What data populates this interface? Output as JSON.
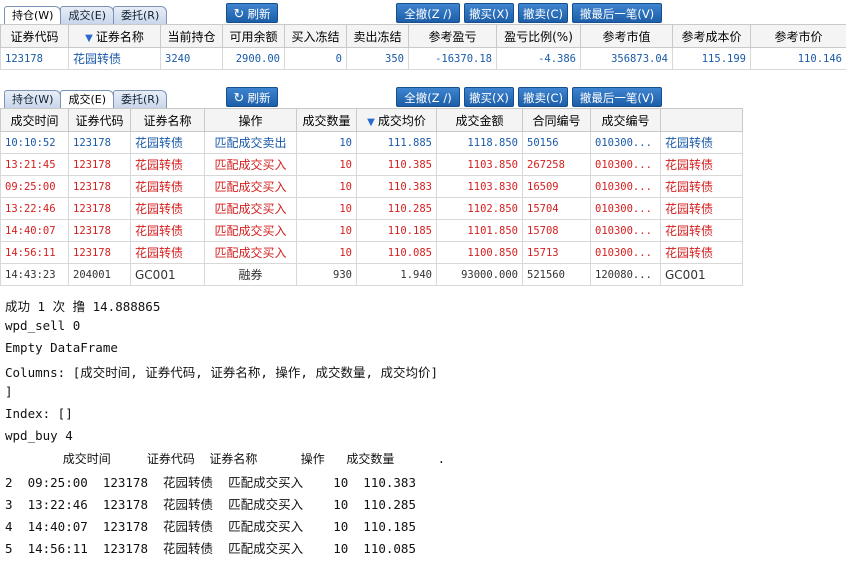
{
  "tabs": [
    "持仓(W)",
    "成交(E)",
    "委托(R)"
  ],
  "buttons": {
    "refresh": "刷新",
    "cancel_all": "全撤(Z /)",
    "cancel_buy": "撤买(X)",
    "cancel_sell": "撤卖(C)",
    "cancel_last": "撤最后一笔(V)"
  },
  "positions": {
    "headers": [
      "证券代码",
      "证券名称",
      "当前持仓",
      "可用余额",
      "买入冻结",
      "卖出冻结",
      "参考盈亏",
      "盈亏比例(%)",
      "参考市值",
      "参考成本价",
      "参考市价"
    ],
    "rows": [
      [
        "123178",
        "花园转债",
        "3240",
        "2900.00",
        "0",
        "350",
        "-16370.18",
        "-4.386",
        "356873.04",
        "115.199",
        "110.146"
      ]
    ]
  },
  "trades": {
    "headers": [
      "成交时间",
      "证券代码",
      "证券名称",
      "操作",
      "成交数量",
      "成交均价",
      "成交金额",
      "合同编号",
      "成交编号",
      ""
    ],
    "rows": [
      {
        "cells": [
          "10:10:52",
          "123178",
          "花园转债",
          "匹配成交卖出",
          "10",
          "111.885",
          "1118.850",
          "50156",
          "010300...",
          "花园转债"
        ],
        "color": "blue"
      },
      {
        "cells": [
          "13:21:45",
          "123178",
          "花园转债",
          "匹配成交买入",
          "10",
          "110.385",
          "1103.850",
          "267258",
          "010300...",
          "花园转债"
        ],
        "color": "red"
      },
      {
        "cells": [
          "09:25:00",
          "123178",
          "花园转债",
          "匹配成交买入",
          "10",
          "110.383",
          "1103.830",
          "16509",
          "010300...",
          "花园转债"
        ],
        "color": "red"
      },
      {
        "cells": [
          "13:22:46",
          "123178",
          "花园转债",
          "匹配成交买入",
          "10",
          "110.285",
          "1102.850",
          "15704",
          "010300...",
          "花园转债"
        ],
        "color": "red"
      },
      {
        "cells": [
          "14:40:07",
          "123178",
          "花园转债",
          "匹配成交买入",
          "10",
          "110.185",
          "1101.850",
          "15708",
          "010300...",
          "花园转债"
        ],
        "color": "red"
      },
      {
        "cells": [
          "14:56:11",
          "123178",
          "花园转债",
          "匹配成交买入",
          "10",
          "110.085",
          "1100.850",
          "15713",
          "010300...",
          "花园转债"
        ],
        "color": "red"
      },
      {
        "cells": [
          "14:43:23",
          "204001",
          "GC001",
          "融券",
          "930",
          "1.940",
          "93000.000",
          "521560",
          "120080...",
          "GC001"
        ],
        "color": "gray"
      }
    ]
  },
  "console_lines": [
    "成功 1 次 撸 14.888865",
    "wpd_sell 0",
    "Empty DataFrame",
    "Columns: [成交时间, 证券代码, 证券名称, 操作, 成交数量, 成交均价]",
    "]",
    "Index: []",
    "wpd_buy 4",
    "        成交时间     证券代码  证券名称      操作   成交数量      .",
    "2  09:25:00  123178  花园转债  匹配成交买入    10  110.383",
    "3  13:22:46  123178  花园转债  匹配成交买入    10  110.285",
    "4  14:40:07  123178  花园转债  匹配成交买入    10  110.185",
    "5  14:56:11  123178  花园转债  匹配成交买入    10  110.085"
  ],
  "colors": {
    "blue": "#1a5aa8",
    "red": "#d42020",
    "button": "#2a6fc0"
  }
}
